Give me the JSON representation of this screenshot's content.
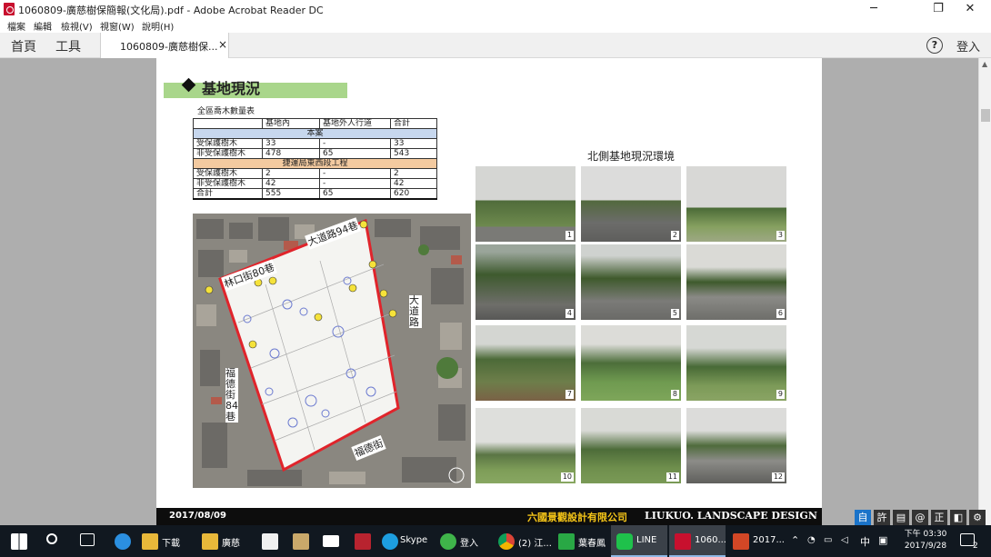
{
  "window": {
    "title": "1060809-廣慈樹保簡報(文化局).pdf - Adobe Acrobat Reader DC",
    "controls": {
      "minimize": "─",
      "restore": "❐",
      "close": "✕"
    }
  },
  "menu": {
    "items": [
      "檔案",
      "編輯",
      "檢視(V)",
      "視窗(W)",
      "說明(H)"
    ]
  },
  "toolbar": {
    "home": "首頁",
    "tools": "工具",
    "doc_tab": "1060809-廣慈樹保...",
    "doc_tab_close": "×",
    "help": "?",
    "sign_in": "登入"
  },
  "slide": {
    "heading": "基地現況",
    "table_caption": "全區喬木數量表",
    "table": {
      "header": [
        "",
        "基地內",
        "基地外人行道",
        "合計"
      ],
      "section1": "本案",
      "section1_rows": [
        [
          "受保護樹木",
          "33",
          "-",
          "33"
        ],
        [
          "非受保護樹木",
          "478",
          "65",
          "543"
        ]
      ],
      "section2": "捷運局東西段工程",
      "section2_rows": [
        [
          "受保護樹木",
          "2",
          "-",
          "2"
        ],
        [
          "非受保護樹木",
          "42",
          "-",
          "42"
        ]
      ],
      "total": [
        "合計",
        "555",
        "65",
        "620"
      ]
    },
    "map_labels": {
      "top": "大道路94巷",
      "left_top": "林口街80巷",
      "right": "大道路",
      "left": "福德街84巷",
      "bottom": "福德街"
    },
    "photos_title": "北側基地現況環境",
    "photo_numbers": [
      "1",
      "2",
      "3",
      "4",
      "5",
      "6",
      "7",
      "8",
      "9",
      "10",
      "11",
      "12"
    ],
    "footer_date": "2017/08/09",
    "footer_company": "六國景觀設計有限公司",
    "footer_brand": "LIUKUO. LANDSCAPE DESIGN"
  },
  "ime_bar": [
    "自",
    "許",
    "▤",
    "@",
    "正",
    "◧",
    "⚙"
  ],
  "taskbar": {
    "items": [
      {
        "label": "",
        "icon": "windows-start-icon"
      },
      {
        "label": "",
        "icon": "search-icon"
      },
      {
        "label": "",
        "icon": "task-view-icon"
      },
      {
        "label": "",
        "icon": "edge-icon"
      },
      {
        "label": "下載",
        "icon": "folder-icon"
      },
      {
        "label": "廣慈",
        "icon": "folder-icon"
      },
      {
        "label": "",
        "icon": "store-icon"
      },
      {
        "label": "",
        "icon": "paint-icon"
      },
      {
        "label": "",
        "icon": "mail-icon"
      },
      {
        "label": "",
        "icon": "app-icon"
      },
      {
        "label": "Skype",
        "icon": "skype-icon"
      },
      {
        "label": "登入",
        "icon": "wechat-icon"
      },
      {
        "label": "(2) 江...",
        "icon": "chrome-icon"
      },
      {
        "label": "葉春鳳",
        "icon": "contact-icon"
      },
      {
        "label": "LINE",
        "icon": "line-icon"
      },
      {
        "label": "1060...",
        "icon": "acrobat-icon"
      },
      {
        "label": "2017...",
        "icon": "powerpoint-icon"
      }
    ],
    "tray_lang": "中",
    "clock_time": "下午 03:30",
    "clock_date": "2017/9/28",
    "notification_count": "2"
  },
  "colors": {
    "heading_bar": "#a9d68b",
    "section1_bg": "#c7d7ee",
    "section2_bg": "#f3caa0",
    "site_outline": "#e0242b",
    "footer_company": "#f5c518"
  }
}
